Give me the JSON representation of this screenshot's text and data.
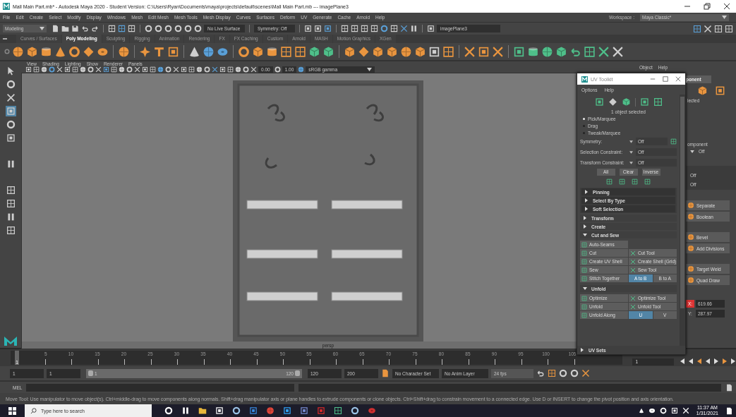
{
  "window": {
    "title": "Mall Main Part.mb* - Autodesk Maya 2020 - Student Version: C:\\Users\\Ryan\\Documents\\maya\\projects\\default\\scenes\\Mall Main Part.mb  ---  imagePlane3"
  },
  "menu_bar": [
    "File",
    "Edit",
    "Create",
    "Select",
    "Modify",
    "Display",
    "Windows",
    "Mesh",
    "Edit Mesh",
    "Mesh Tools",
    "Mesh Display",
    "Curves",
    "Surfaces",
    "Deform",
    "UV",
    "Generate",
    "Cache",
    "Arnold",
    "Help"
  ],
  "workspace": {
    "label": "Workspace :",
    "value": "Maya Classic*"
  },
  "status_line": {
    "menu_set": "Modeling",
    "live_surface": "No Live Surface",
    "symmetry": "Symmetry: Off",
    "camera_field": "imagePlane3"
  },
  "shelf": {
    "tabs": [
      {
        "label": "Curves / Surfaces",
        "selected": false
      },
      {
        "label": "Poly Modeling",
        "selected": true
      },
      {
        "label": "Sculpting",
        "selected": false
      },
      {
        "label": "Rigging",
        "selected": false
      },
      {
        "label": "Animation",
        "selected": false
      },
      {
        "label": "Rendering",
        "selected": false
      },
      {
        "label": "FX",
        "selected": false
      },
      {
        "label": "FX Caching",
        "selected": false
      },
      {
        "label": "Custom",
        "selected": false
      },
      {
        "label": "Arnold",
        "selected": false
      },
      {
        "label": "MASH",
        "selected": false
      },
      {
        "label": "Motion Graphics",
        "selected": false
      },
      {
        "label": "XGen",
        "selected": false
      }
    ]
  },
  "viewport": {
    "menus": [
      "View",
      "Shading",
      "Lighting",
      "Show",
      "Renderer",
      "Panels"
    ],
    "exposure": "0.00",
    "gamma": "1.00",
    "color_space": "sRGB gamma",
    "camera": "persp"
  },
  "modeling_toolkit": {
    "menus": [
      "Object",
      "Help"
    ],
    "tab": "ponent",
    "selection_text": "lected",
    "component_text": "omponent",
    "constraint_value": "Off",
    "values": [
      "Off",
      "Off"
    ],
    "button_groups": [
      [
        "Separate",
        "Boolean"
      ],
      [
        "Bevel",
        "Add Divisions"
      ],
      [
        "Target Weld",
        "Quad Draw"
      ]
    ],
    "coords": [
      {
        "axis": "X:",
        "value": "619.66",
        "selected": true
      },
      {
        "axis": "Y:",
        "value": "287.97",
        "selected": false
      }
    ]
  },
  "uv_toolkit": {
    "title": "UV Toolkit",
    "menus": [
      "Options",
      "Help"
    ],
    "selection_info": "1 object selected",
    "radios": [
      {
        "label": "Pick/Marquee",
        "selected": true
      },
      {
        "label": "Drag",
        "selected": false
      },
      {
        "label": "Tweak/Marquee",
        "selected": false
      }
    ],
    "fields": [
      {
        "label": "Symmetry:",
        "value": "Off"
      },
      {
        "label": "Selection Constraint:",
        "value": "Off"
      },
      {
        "label": "Transform Constraint:",
        "value": "Off"
      }
    ],
    "select_buttons": [
      "All",
      "Clear",
      "Inverse"
    ],
    "subsections": [
      {
        "label": "Pinning",
        "expanded": false
      },
      {
        "label": "Select By Type",
        "expanded": false
      },
      {
        "label": "Soft Selection",
        "expanded": false
      }
    ],
    "sections": [
      {
        "label": "Transform",
        "expanded": false
      },
      {
        "label": "Create",
        "expanded": false
      },
      {
        "label": "Cut and Sew",
        "expanded": true,
        "rows": [
          [
            {
              "kind": "button",
              "label": "Auto-Seams"
            }
          ],
          [
            {
              "kind": "button",
              "label": "Cut"
            },
            {
              "kind": "button",
              "label": "Cut Tool"
            }
          ],
          [
            {
              "kind": "button",
              "label": "Create UV Shell"
            },
            {
              "kind": "button",
              "label": "Create Shell (Grid)"
            }
          ],
          [
            {
              "kind": "button",
              "label": "Sew"
            },
            {
              "kind": "button",
              "label": "Sew Tool"
            }
          ],
          [
            {
              "kind": "button",
              "label": "Stitch Together"
            },
            {
              "kind": "toggle",
              "options": [
                {
                  "label": "A to B",
                  "selected": true
                },
                {
                  "label": "B to A",
                  "selected": false
                }
              ]
            }
          ]
        ]
      },
      {
        "label": "Unfold",
        "expanded": true,
        "rows": [
          [
            {
              "kind": "button",
              "label": "Optimize"
            },
            {
              "kind": "button",
              "label": "Optimize Tool"
            }
          ],
          [
            {
              "kind": "button",
              "label": "Unfold"
            },
            {
              "kind": "button",
              "label": "Unfold Tool"
            }
          ],
          [
            {
              "kind": "button",
              "label": "Unfold Along"
            },
            {
              "kind": "toggle",
              "options": [
                {
                  "label": "U",
                  "selected": true
                },
                {
                  "label": "V",
                  "selected": false
                }
              ]
            }
          ]
        ]
      }
    ],
    "footer_section": {
      "label": "UV Sets",
      "expanded": false
    }
  },
  "time_slider": {
    "current_frame": "1",
    "level": 0,
    "labels": [
      "5",
      "10",
      "15",
      "20",
      "25",
      "30",
      "35",
      "40",
      "45",
      "50",
      "55",
      "60",
      "65",
      "70",
      "75",
      "80",
      "85",
      "90",
      "95",
      "100",
      "105"
    ],
    "frame_field": "1"
  },
  "range_slider": {
    "level": 1,
    "start": "1",
    "playback_start": "1",
    "range_start": "1",
    "range_end": "120",
    "playback_end": "120",
    "end": "200",
    "character_set": "No Character Set",
    "anim_layer": "No Anim Layer",
    "fps": "24 fps"
  },
  "command_line": {
    "label": "MEL"
  },
  "help_line": "Move Tool: Use manipulator to move object(s). Ctrl+middle-drag to move components along normals. Shift+drag manipulator axis or plane handles to extrude components or clone objects. Ctrl+Shift+drag to constrain movement to a connected edge. Use D or INSERT to change the pivot position and axis orientation.",
  "taskbar": {
    "search_placeholder": "Type here to search",
    "time": "11:37 AM",
    "date": "1/31/2021"
  }
}
